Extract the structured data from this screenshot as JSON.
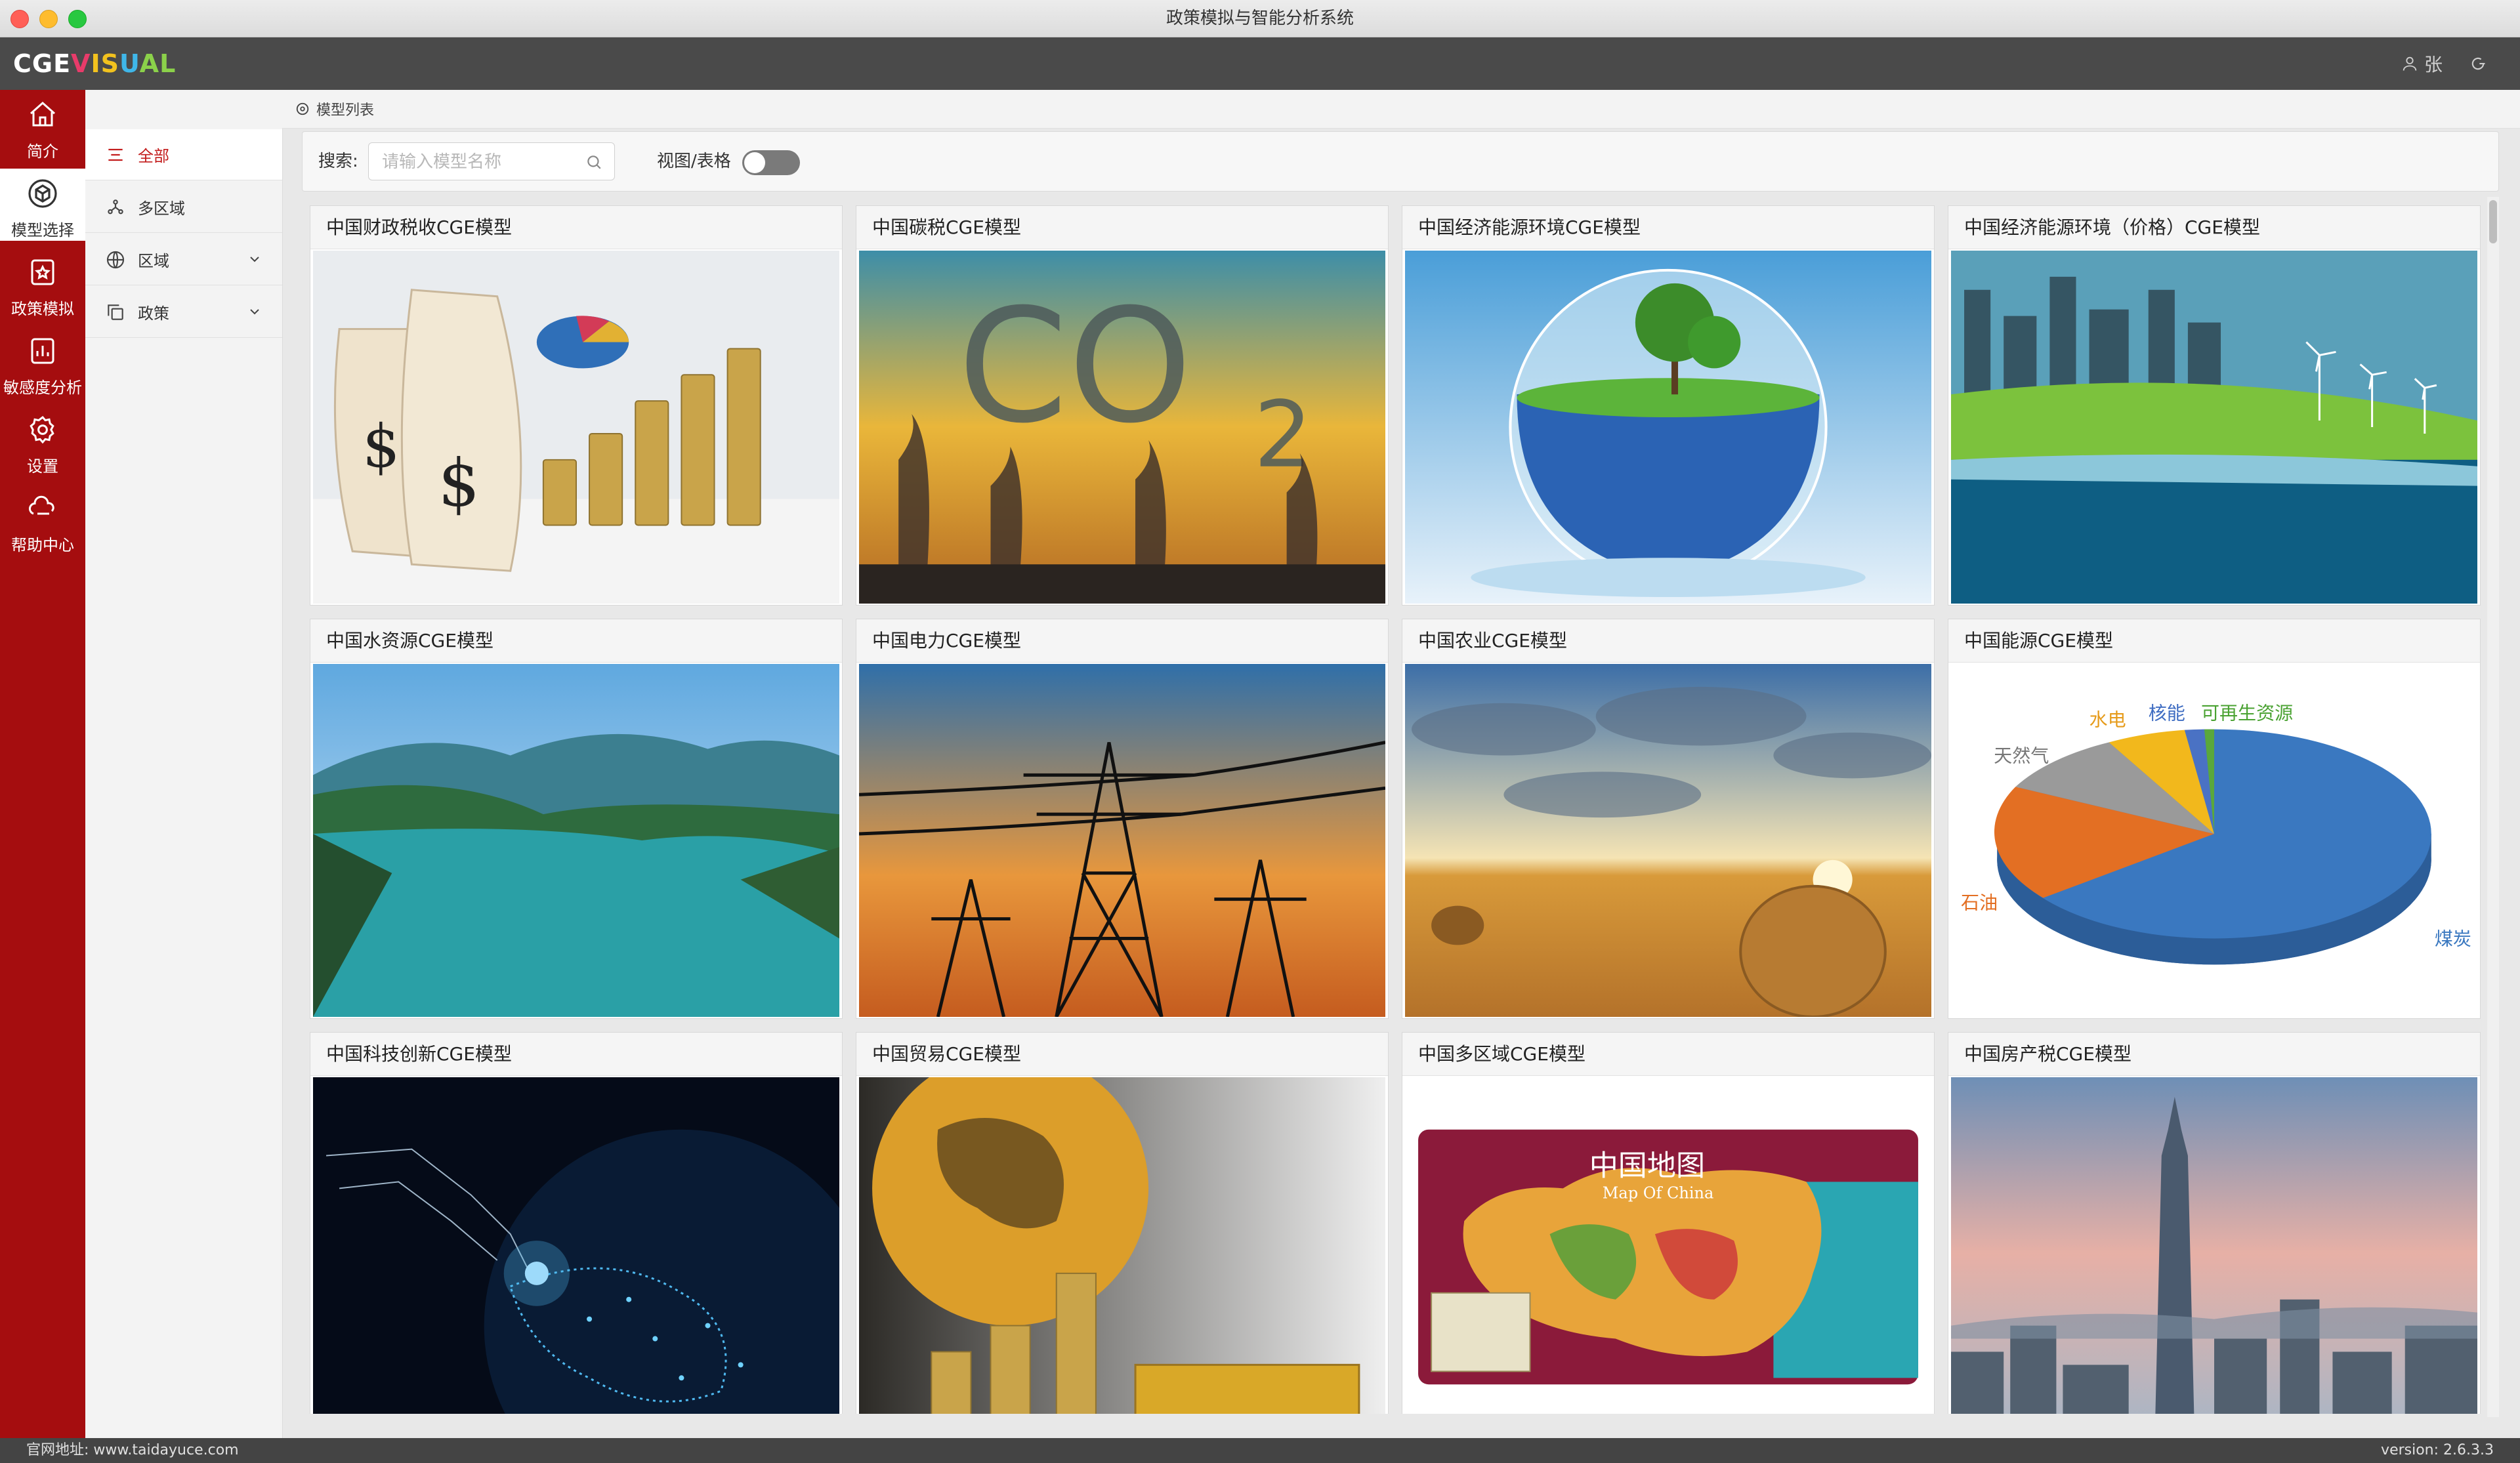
{
  "window": {
    "title": "政策模拟与智能分析系统"
  },
  "app": {
    "logo_a": "CGE",
    "logo_b": "V",
    "logo_c": "IS",
    "logo_d": "U",
    "logo_e": "AL",
    "user_name": "张"
  },
  "leftnav": {
    "items": [
      {
        "label": "简介",
        "icon": "home-icon"
      },
      {
        "label": "模型选择",
        "icon": "cube-icon"
      },
      {
        "label": "政策模拟",
        "icon": "star-doc-icon"
      },
      {
        "label": "敏感度分析",
        "icon": "chart-doc-icon"
      },
      {
        "label": "设置",
        "icon": "gear-icon"
      },
      {
        "label": "帮助中心",
        "icon": "cloud-hand-icon"
      }
    ],
    "active": "模型选择"
  },
  "subnav": {
    "items": [
      {
        "label": "全部",
        "icon": "list-icon"
      },
      {
        "label": "多区域",
        "icon": "network-icon"
      },
      {
        "label": "区域",
        "icon": "globe-icon"
      },
      {
        "label": "政策",
        "icon": "copy-icon"
      }
    ],
    "active": "全部"
  },
  "breadcrumb": {
    "label": "模型列表"
  },
  "search": {
    "label": "搜索:",
    "placeholder": "请输入模型名称",
    "value": "",
    "view_toggle_label": "视图/表格",
    "view_toggle_on": false
  },
  "cards": [
    {
      "title": "中国财政税收CGE模型"
    },
    {
      "title": "中国碳税CGE模型"
    },
    {
      "title": "中国经济能源环境CGE模型"
    },
    {
      "title": "中国经济能源环境（价格）CGE模型"
    },
    {
      "title": "中国水资源CGE模型"
    },
    {
      "title": "中国电力CGE模型"
    },
    {
      "title": "中国农业CGE模型"
    },
    {
      "title": "中国能源CGE模型"
    },
    {
      "title": "中国科技创新CGE模型"
    },
    {
      "title": "中国贸易CGE模型"
    },
    {
      "title": "中国多区域CGE模型"
    },
    {
      "title": "中国房产税CGE模型"
    }
  ],
  "card_image_text": {
    "co2": "CO",
    "co2_sub": "2",
    "map_title": "中国地图",
    "map_sub": "Map Of China",
    "pie_labels": {
      "hydro": "水电",
      "nuclear": "核能",
      "renewable": "可再生资源",
      "gas": "天然气",
      "oil": "石油",
      "coal": "煤炭"
    }
  },
  "footer": {
    "website": "官网地址: www.taidayuce.com",
    "version": "version: 2.6.3.3"
  },
  "colors": {
    "nav_red": "#a50d0f",
    "header_gray": "#4a4a4a",
    "active_text_red": "#c31d1d"
  }
}
